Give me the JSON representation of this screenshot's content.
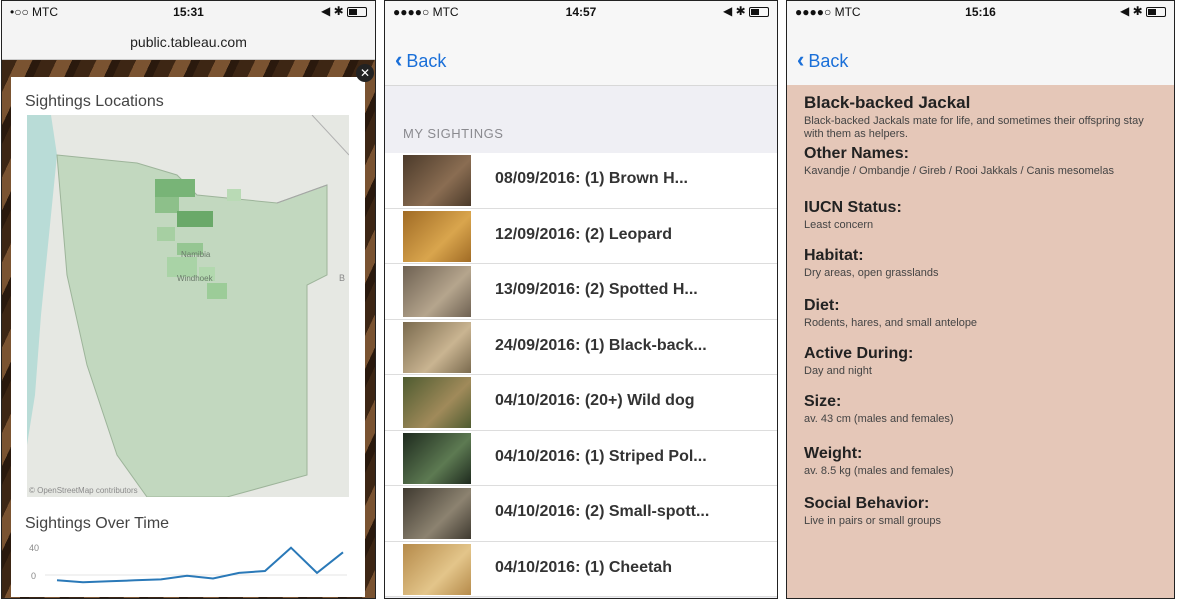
{
  "panel1": {
    "status": {
      "carrier": "•○○ MTC",
      "time": "15:31",
      "right": "◀ ✱"
    },
    "url": "public.tableau.com",
    "close_label": "✕",
    "map": {
      "title": "Sightings Locations",
      "place_labels": [
        "Namibia",
        "Windhoek"
      ],
      "edge_label": "B",
      "attribution": "© OpenStreetMap contributors"
    },
    "trend": {
      "title": "Sightings Over Time",
      "chart_data": {
        "type": "line",
        "values": [
          0,
          -2,
          -1,
          0,
          1,
          5,
          2,
          8,
          10,
          35,
          8,
          30
        ],
        "yticks": [
          "40",
          "0"
        ],
        "ylim": [
          -5,
          40
        ]
      }
    }
  },
  "panel2": {
    "status": {
      "carrier": "●●●●○ MTC",
      "time": "14:57",
      "right": "◀ ✱"
    },
    "back_label": "Back",
    "section_title": "MY SIGHTINGS",
    "items": [
      {
        "label": "08/09/2016: (1)  Brown H...",
        "colors": [
          "#4b3a2a",
          "#8a6d52"
        ]
      },
      {
        "label": "12/09/2016: (2) Leopard",
        "colors": [
          "#a06b25",
          "#d9a54d"
        ]
      },
      {
        "label": "13/09/2016: (2) Spotted  H...",
        "colors": [
          "#6e6152",
          "#b5a58d"
        ]
      },
      {
        "label": "24/09/2016: (1) Black-back...",
        "colors": [
          "#7a6a4e",
          "#c9b491"
        ]
      },
      {
        "label": "04/10/2016: (20+) Wild dog",
        "colors": [
          "#4e5b30",
          "#a08a5a"
        ]
      },
      {
        "label": "04/10/2016: (1) Striped Pol...",
        "colors": [
          "#1e2a1e",
          "#5d7a52"
        ]
      },
      {
        "label": "04/10/2016: (2) Small-spott...",
        "colors": [
          "#3f3a30",
          "#8c8270"
        ]
      },
      {
        "label": "04/10/2016: (1) Cheetah",
        "colors": [
          "#b58a4a",
          "#e3c58a"
        ]
      }
    ]
  },
  "panel3": {
    "status": {
      "carrier": "●●●●○ MTC",
      "time": "15:16",
      "right": "◀ ✱"
    },
    "back_label": "Back",
    "facts": [
      {
        "heading": "Black-backed Jackal",
        "text": "Black-backed Jackals mate for life, and sometimes their offspring stay with them as helpers."
      },
      {
        "heading": "Other Names:",
        "text": "Kavandje / Ombandje / Gireb / Rooi Jakkals / Canis mesomelas"
      },
      {
        "heading": "IUCN Status:",
        "text": "Least concern"
      },
      {
        "heading": "Habitat:",
        "text": "Dry areas, open grasslands"
      },
      {
        "heading": "Diet:",
        "text": "Rodents, hares, and small antelope"
      },
      {
        "heading": "Active During:",
        "text": "Day and night"
      },
      {
        "heading": "Size:",
        "text": "av. 43 cm (males and females)"
      },
      {
        "heading": "Weight:",
        "text": "av. 8.5 kg (males and females)"
      },
      {
        "heading": "Social Behavior:",
        "text": "Live in pairs or small groups"
      }
    ]
  }
}
